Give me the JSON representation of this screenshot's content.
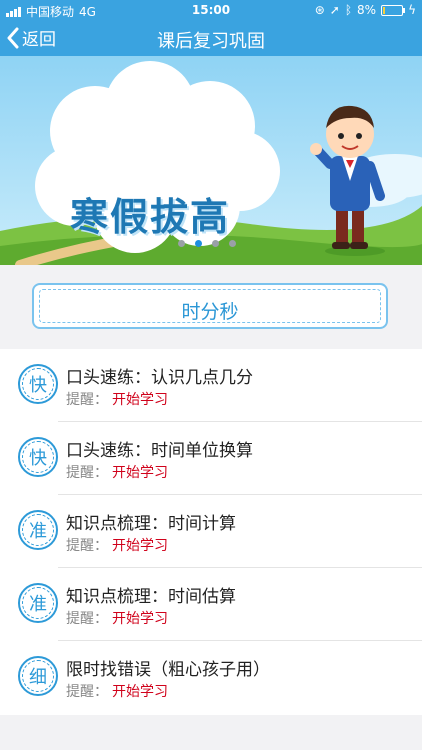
{
  "status": {
    "carrier": "中国移动",
    "network": "4G",
    "time": "15:00",
    "battery": "8%",
    "battery_level": 0.08
  },
  "nav": {
    "back_label": "返回",
    "title": "课后复习巩固"
  },
  "banner": {
    "title": "寒假拔高",
    "dots_total": 4,
    "active_dot": 2
  },
  "section": {
    "title": "时分秒"
  },
  "list": {
    "items": [
      {
        "badge": "快",
        "title": "口头速练：认识几点几分",
        "hint_label": "提醒：",
        "action": "开始学习"
      },
      {
        "badge": "快",
        "title": "口头速练：时间单位换算",
        "hint_label": "提醒：",
        "action": "开始学习"
      },
      {
        "badge": "准",
        "title": "知识点梳理：时间计算",
        "hint_label": "提醒：",
        "action": "开始学习"
      },
      {
        "badge": "准",
        "title": "知识点梳理：时间估算",
        "hint_label": "提醒：",
        "action": "开始学习"
      },
      {
        "badge": "细",
        "title": "限时找错误（粗心孩子用）",
        "hint_label": "提醒：",
        "action": "开始学习"
      }
    ]
  },
  "colors": {
    "header_blue": "#3aa3e0",
    "accent_blue": "#2d9ad8",
    "action_red": "#d0021b"
  }
}
